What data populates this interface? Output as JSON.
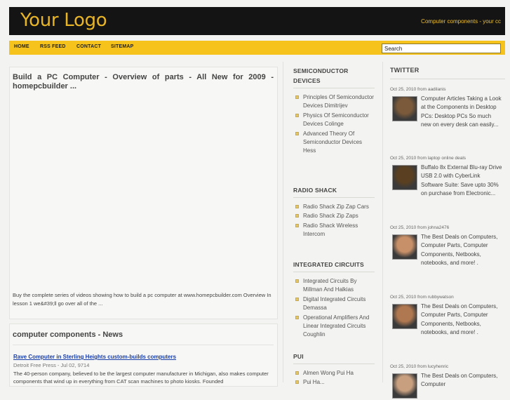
{
  "header": {
    "logo": "Your Logo",
    "tagline": "Computer components - your cc"
  },
  "nav": {
    "items": [
      "HOME",
      "RSS FEED",
      "CONTACT",
      "SITEMAP"
    ],
    "search_value": "Search"
  },
  "post": {
    "title": "Build a PC Computer - Overview of parts - All New for 2009 - homepcbuilder ...",
    "description": "Buy the complete series of videos showing how to build a pc computer at www.homepcbuilder.com Overview In lesson 1 we&#39;ll go over all of the ..."
  },
  "news": {
    "heading": "computer components - News",
    "link": "Rave Computer in Sterling Heights custom-builds computers",
    "source": "Detroit Free Press - Jul 02, 9714",
    "snippet": "The 40-person company, believed to be the largest computer manufacturer in Michigan, also makes computer components that wind up in everything from CAT scan machines to photo kiosks. Founded"
  },
  "sidebar": {
    "sections": [
      {
        "heading": "SEMICONDUCTOR DEVICES",
        "items": [
          "Principles Of Semiconductor Devices Dimitrijev",
          "Physics Of Semiconductor Devices Colinge",
          "Advanced Theory Of Semiconductor Devices Hess"
        ]
      },
      {
        "heading": "RADIO SHACK",
        "items": [
          "Radio Shack Zip Zap Cars",
          "Radio Shack Zip Zaps",
          "Radio Shack Wireless Intercom"
        ]
      },
      {
        "heading": "INTEGRATED CIRCUITS",
        "items": [
          "Integrated Circuits By Millman And Halkias",
          "Digital Integrated Circuits Demassa",
          "Operational Amplifiers And Linear Integrated Circuits Coughlin"
        ]
      },
      {
        "heading": "PUI",
        "items": [
          "Almen Wong Pui Ha",
          "Pui Ha..."
        ]
      }
    ]
  },
  "twitter": {
    "heading": "TWITTER",
    "tweets": [
      {
        "meta": "Oct 25, 2010 from aadilanis",
        "text": "Computer Articles Taking a Look at the Components in Desktop PCs: Desktop PCs So much new on every desk can easily...",
        "avatar_color": "#7a5a3a"
      },
      {
        "meta": "Oct 25, 2010 from laptop online deals",
        "text": "Buffalo 8x External Blu-ray Drive USB 2.0 with CyberLink Software Suite: Save upto 30% on purchase from Electronic...",
        "avatar_color": "#5a4020"
      },
      {
        "meta": "Oct 25, 2010 from johna2476",
        "text": "The Best Deals on Computers, Computer Parts, Computer Components, Netbooks, notebooks, and more! .",
        "avatar_color": "#c89068"
      },
      {
        "meta": "Oct 25, 2010 from rubbywatson",
        "text": "The Best Deals on Computers, Computer Parts, Computer Components, Netbooks, notebooks, and more! .",
        "avatar_color": "#b07850"
      },
      {
        "meta": "Oct 25, 2010 from lucyhenric",
        "text": "The Best Deals on Computers, Computer",
        "avatar_color": "#c8a080"
      }
    ]
  }
}
